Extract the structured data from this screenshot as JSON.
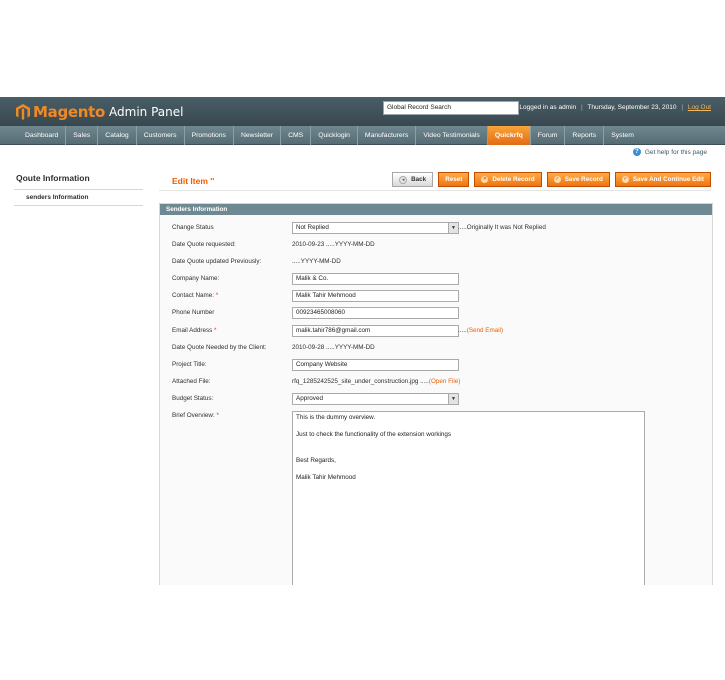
{
  "header": {
    "logo_text": "Magento",
    "logo_sub": "Admin Panel",
    "search_value": "Global Record Search",
    "logged_in": "Logged in as admin",
    "separator": "|",
    "date": "Thursday, September 23, 2010",
    "logout": "Log Out"
  },
  "nav": {
    "items": [
      "Dashboard",
      "Sales",
      "Catalog",
      "Customers",
      "Promotions",
      "Newsletter",
      "CMS",
      "Quicklogin",
      "Manufacturers",
      "Video Testimonials",
      "Quickrfq",
      "Forum",
      "Reports",
      "System"
    ],
    "active": "Quickrfq"
  },
  "help": {
    "text": "Get help for this page",
    "icon": "help-icon"
  },
  "sidebar": {
    "title": "Qoute Information",
    "tab": "senders Information"
  },
  "main": {
    "title": "Edit Item ''",
    "buttons": {
      "back": "Back",
      "reset": "Reset",
      "delete": "Delete Record",
      "save": "Save Record",
      "save_continue": "Save And Continue Edit"
    },
    "section_title": "Senders Information"
  },
  "form": {
    "change_status": {
      "label": "Change Status",
      "value": "Not Replied",
      "note": ".....Originally It was Not Replied"
    },
    "date_requested": {
      "label": "Date Quote requested:",
      "value": "2010-09-23 .....YYYY-MM-DD"
    },
    "date_updated": {
      "label": "Date Quote updated Previously:",
      "value": ".....YYYY-MM-DD"
    },
    "company": {
      "label": "Company Name:",
      "value": "Malik & Co."
    },
    "contact": {
      "label": "Contact Name:",
      "req": "*",
      "value": "Malik Tahir Mehmood"
    },
    "phone": {
      "label": "Phone Number",
      "value": "00923465008060"
    },
    "email": {
      "label": "Email Address",
      "req": "*",
      "value": "malik.tahir786@gmail.com",
      "link_prefix": ".....",
      "link": "(Send Email)"
    },
    "date_needed": {
      "label": "Date Quote Needed by the Client:",
      "value": "2010-09-28 .....YYYY-MM-DD"
    },
    "project": {
      "label": "Project Title:",
      "value": "Company Website"
    },
    "file": {
      "label": "Attached File:",
      "value": "rfq_1285242525_site_under_construction.jpg",
      "link_prefix": ".....",
      "link": "(Open File)"
    },
    "budget": {
      "label": "Budget Status:",
      "value": "Approved"
    },
    "overview": {
      "label": "Brief Overview:",
      "req": "*",
      "lines": [
        "This is the dummy overview.",
        "",
        "Just to check the functionality of the extension workings",
        "",
        "",
        "Best Regards,",
        "",
        "Malik Tahir Mehmood"
      ]
    }
  },
  "colors": {
    "accent": "#eb5e00",
    "header": "#3f5159",
    "section": "#6f8992"
  }
}
